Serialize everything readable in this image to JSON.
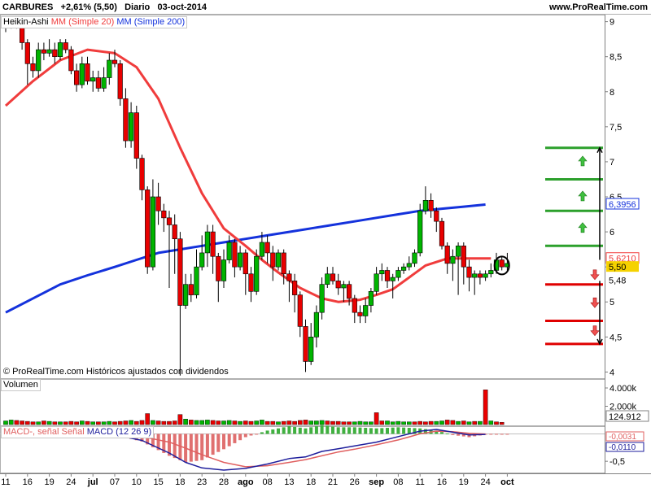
{
  "header": {
    "ticker": "CARBURES",
    "change": "+2,61% (5,50)",
    "period": "Diario",
    "date": "03-oct-2014",
    "site": "www.ProRealTime.com"
  },
  "copyright": "© ProRealTime.com Históricos ajustados con dividendos",
  "colors": {
    "up": "#00b400",
    "down": "#e80000",
    "sma20": "#f03c3c",
    "sma200": "#1432dc",
    "green_line": "#2ca02c",
    "red_line": "#e00000",
    "macd": "#1e1e9c",
    "signal": "#e06060"
  },
  "price_legend": {
    "ha": "Heikin-Ashi",
    "ma20": "MM (Simple 20)",
    "ma200": "MM (Simple 200)"
  },
  "volume_legend": "Volumen",
  "macd_legend": {
    "macd_hist": "MACD-, señal",
    "signal": "Señal",
    "macd": "MACD (12 26 9)"
  },
  "chart_data": [
    {
      "type": "candlestick",
      "title": "CARBURES",
      "ylim": [
        3.9,
        9.1
      ],
      "y_ticks": [
        "9",
        "8,5",
        "8",
        "7,5",
        "7",
        "6,5",
        "6",
        "5,5",
        "5",
        "4,5",
        "4"
      ],
      "x_date_labels": [
        "11",
        "16",
        "19",
        "24",
        "jul",
        "07",
        "10",
        "15",
        "18",
        "23",
        "28",
        "ago",
        "08",
        "13",
        "18",
        "21",
        "26",
        "sep",
        "08",
        "11",
        "16",
        "19",
        "24",
        "oct"
      ],
      "candles": [
        [
          8.95,
          8.95,
          9.05,
          8.85
        ],
        [
          8.95,
          9.0,
          9.05,
          8.9
        ],
        [
          9.0,
          8.95,
          9.05,
          8.9
        ],
        [
          8.95,
          8.7,
          8.95,
          8.6
        ],
        [
          8.7,
          8.4,
          8.75,
          8.1
        ],
        [
          8.4,
          8.3,
          8.5,
          8.2
        ],
        [
          8.3,
          8.6,
          8.7,
          8.2
        ],
        [
          8.6,
          8.55,
          8.7,
          8.45
        ],
        [
          8.55,
          8.6,
          8.75,
          8.5
        ],
        [
          8.6,
          8.5,
          8.7,
          8.4
        ],
        [
          8.5,
          8.7,
          8.75,
          8.45
        ],
        [
          8.7,
          8.6,
          8.75,
          8.55
        ],
        [
          8.6,
          8.3,
          8.65,
          8.25
        ],
        [
          8.3,
          8.1,
          8.4,
          8.0
        ],
        [
          8.1,
          8.4,
          8.5,
          8.05
        ],
        [
          8.4,
          8.15,
          8.5,
          8.1
        ],
        [
          8.15,
          8.2,
          8.3,
          8.0
        ],
        [
          8.2,
          8.05,
          8.3,
          8.0
        ],
        [
          8.05,
          8.2,
          8.35,
          8.0
        ],
        [
          8.2,
          8.45,
          8.55,
          8.1
        ],
        [
          8.45,
          8.4,
          8.6,
          8.35
        ],
        [
          8.4,
          7.9,
          8.45,
          7.8
        ],
        [
          7.9,
          7.3,
          8.05,
          7.2
        ],
        [
          7.3,
          7.7,
          7.85,
          7.2
        ],
        [
          7.7,
          7.05,
          7.8,
          6.9
        ],
        [
          7.05,
          6.6,
          7.1,
          6.45
        ],
        [
          6.6,
          5.5,
          6.65,
          5.4
        ],
        [
          5.5,
          6.5,
          6.75,
          5.45
        ],
        [
          6.5,
          6.3,
          6.7,
          6.1
        ],
        [
          6.3,
          6.2,
          6.4,
          6.0
        ],
        [
          6.2,
          6.1,
          6.3,
          5.2
        ],
        [
          6.1,
          5.9,
          6.25,
          5.4
        ],
        [
          5.9,
          4.95,
          6.0,
          3.95
        ],
        [
          4.95,
          5.25,
          5.4,
          4.9
        ],
        [
          5.25,
          5.1,
          5.4,
          5.0
        ],
        [
          5.1,
          5.5,
          5.75,
          5.05
        ],
        [
          5.5,
          5.7,
          5.95,
          5.45
        ],
        [
          5.7,
          6.0,
          6.1,
          5.5
        ],
        [
          6.0,
          5.65,
          6.1,
          5.4
        ],
        [
          5.65,
          5.3,
          5.7,
          5.0
        ],
        [
          5.3,
          5.6,
          5.75,
          5.2
        ],
        [
          5.6,
          5.85,
          5.95,
          5.55
        ],
        [
          5.85,
          5.5,
          5.9,
          5.35
        ],
        [
          5.5,
          5.7,
          5.8,
          5.45
        ],
        [
          5.7,
          5.4,
          5.75,
          5.1
        ],
        [
          5.4,
          5.15,
          5.5,
          5.0
        ],
        [
          5.15,
          5.65,
          5.75,
          5.1
        ],
        [
          5.65,
          5.85,
          6.0,
          5.6
        ],
        [
          5.85,
          5.7,
          5.95,
          5.55
        ],
        [
          5.7,
          5.5,
          5.8,
          5.3
        ],
        [
          5.5,
          5.7,
          5.75,
          5.45
        ],
        [
          5.7,
          5.4,
          5.75,
          5.25
        ],
        [
          5.4,
          5.3,
          5.45,
          5.0
        ],
        [
          5.3,
          5.1,
          5.4,
          4.85
        ],
        [
          5.1,
          4.65,
          5.15,
          4.5
        ],
        [
          4.65,
          4.15,
          4.75,
          4.0
        ],
        [
          4.15,
          4.5,
          4.7,
          4.1
        ],
        [
          4.5,
          4.85,
          4.95,
          4.35
        ],
        [
          4.85,
          5.25,
          5.35,
          4.75
        ],
        [
          5.25,
          5.4,
          5.5,
          5.2
        ],
        [
          5.4,
          5.3,
          5.5,
          5.25
        ],
        [
          5.3,
          5.2,
          5.4,
          5.1
        ],
        [
          5.2,
          5.25,
          5.3,
          5.0
        ],
        [
          5.25,
          5.05,
          5.3,
          4.95
        ],
        [
          5.05,
          4.85,
          5.1,
          4.7
        ],
        [
          4.85,
          4.8,
          4.95,
          4.7
        ],
        [
          4.8,
          4.95,
          5.05,
          4.7
        ],
        [
          4.95,
          5.15,
          5.2,
          4.85
        ],
        [
          5.15,
          5.4,
          5.5,
          5.1
        ],
        [
          5.4,
          5.45,
          5.55,
          5.3
        ],
        [
          5.45,
          5.3,
          5.5,
          5.2
        ],
        [
          5.3,
          5.35,
          5.4,
          5.05
        ],
        [
          5.35,
          5.45,
          5.5,
          5.3
        ],
        [
          5.45,
          5.5,
          5.55,
          5.4
        ],
        [
          5.5,
          5.55,
          5.65,
          5.45
        ],
        [
          5.55,
          5.7,
          5.75,
          5.5
        ],
        [
          5.7,
          6.3,
          6.4,
          5.65
        ],
        [
          6.3,
          6.45,
          6.65,
          6.25
        ],
        [
          6.45,
          6.3,
          6.55,
          6.2
        ],
        [
          6.3,
          6.15,
          6.35,
          6.0
        ],
        [
          6.15,
          5.8,
          6.2,
          5.75
        ],
        [
          5.8,
          5.55,
          5.85,
          5.4
        ],
        [
          5.55,
          5.65,
          5.75,
          5.3
        ],
        [
          5.65,
          5.8,
          5.85,
          5.1
        ],
        [
          5.8,
          5.5,
          5.85,
          5.25
        ],
        [
          5.5,
          5.35,
          5.6,
          5.15
        ],
        [
          5.35,
          5.4,
          5.45,
          5.1
        ],
        [
          5.4,
          5.35,
          5.45,
          5.25
        ],
        [
          5.35,
          5.4,
          5.45,
          5.3
        ],
        [
          5.4,
          5.45,
          5.55,
          5.35
        ],
        [
          5.45,
          5.6,
          5.7,
          5.4
        ],
        [
          5.6,
          5.5,
          5.65,
          5.45
        ],
        [
          5.5,
          5.55,
          5.7,
          5.45
        ]
      ],
      "sma20": [
        [
          0,
          7.8
        ],
        [
          5,
          8.15
        ],
        [
          10,
          8.45
        ],
        [
          15,
          8.6
        ],
        [
          20,
          8.55
        ],
        [
          24,
          8.35
        ],
        [
          28,
          7.9
        ],
        [
          32,
          7.2
        ],
        [
          36,
          6.55
        ],
        [
          40,
          6.05
        ],
        [
          44,
          5.8
        ],
        [
          47,
          5.6
        ],
        [
          50,
          5.42
        ],
        [
          54,
          5.2
        ],
        [
          58,
          5.05
        ],
        [
          61,
          5.0
        ],
        [
          65,
          5.03
        ],
        [
          68,
          5.1
        ],
        [
          71,
          5.18
        ],
        [
          74,
          5.35
        ],
        [
          77,
          5.52
        ],
        [
          81,
          5.62
        ],
        [
          85,
          5.62
        ],
        [
          89,
          5.62
        ]
      ],
      "sma200": [
        [
          0,
          4.85
        ],
        [
          5,
          5.05
        ],
        [
          10,
          5.25
        ],
        [
          15,
          5.38
        ],
        [
          20,
          5.5
        ],
        [
          24,
          5.6
        ],
        [
          28,
          5.7
        ],
        [
          32,
          5.75
        ],
        [
          36,
          5.8
        ],
        [
          40,
          5.85
        ],
        [
          44,
          5.9
        ],
        [
          48,
          5.95
        ],
        [
          52,
          6.0
        ],
        [
          56,
          6.05
        ],
        [
          60,
          6.1
        ],
        [
          64,
          6.15
        ],
        [
          68,
          6.2
        ],
        [
          72,
          6.25
        ],
        [
          76,
          6.3
        ],
        [
          80,
          6.33
        ],
        [
          84,
          6.36
        ],
        [
          88,
          6.39
        ]
      ],
      "levels": {
        "green": [
          7.2,
          6.75,
          6.3,
          5.8
        ],
        "red": [
          5.25,
          4.73,
          4.4
        ]
      },
      "price_tags": {
        "sma200": "6,3956",
        "sma20": "5,6210",
        "last": "5,50",
        "low": "5,48"
      }
    },
    {
      "type": "bar",
      "title": "Volumen",
      "y_ticks": [
        "4.000k",
        "2.000k"
      ],
      "ylim": [
        0,
        4800
      ],
      "last_value": "124.912",
      "values": [
        400,
        500,
        450,
        400,
        350,
        300,
        300,
        400,
        350,
        300,
        300,
        300,
        350,
        300,
        400,
        350,
        300,
        300,
        300,
        350,
        300,
        350,
        400,
        450,
        350,
        450,
        1200,
        450,
        400,
        350,
        350,
        400,
        1100,
        600,
        500,
        450,
        450,
        500,
        450,
        400,
        400,
        450,
        400,
        350,
        400,
        350,
        400,
        500,
        350,
        350,
        300,
        350,
        400,
        350,
        450,
        500,
        400,
        400,
        450,
        400,
        350,
        350,
        300,
        300,
        300,
        350,
        300,
        300,
        1300,
        400,
        400,
        300,
        350,
        300,
        300,
        300,
        350,
        300,
        350,
        350,
        400,
        500,
        450,
        350,
        400,
        300,
        350,
        350,
        3800,
        400,
        300,
        250
      ],
      "up": [
        1,
        1,
        0,
        0,
        0,
        0,
        1,
        0,
        1,
        0,
        1,
        0,
        0,
        0,
        1,
        0,
        1,
        0,
        1,
        1,
        0,
        0,
        0,
        1,
        0,
        0,
        0,
        1,
        0,
        0,
        0,
        0,
        0,
        1,
        0,
        1,
        1,
        1,
        0,
        0,
        1,
        1,
        0,
        1,
        0,
        0,
        1,
        1,
        0,
        0,
        1,
        0,
        0,
        0,
        0,
        0,
        1,
        1,
        1,
        0,
        0,
        0,
        0,
        0,
        1,
        1,
        1,
        1,
        0,
        0,
        1,
        1,
        1,
        1,
        1,
        0,
        0,
        0,
        0,
        1,
        1,
        0,
        0,
        1,
        0,
        1,
        0,
        1,
        0,
        1,
        0
      ]
    },
    {
      "type": "line",
      "title": "MACD (12 26 9)",
      "y_ticks": [
        "-0,5"
      ],
      "ylim": [
        -0.72,
        0.14
      ],
      "values_shown": {
        "signal": "-0,0031",
        "macd": "-0,0110"
      },
      "macd": [
        [
          0,
          0.02
        ],
        [
          5,
          0.02
        ],
        [
          10,
          0.01
        ],
        [
          15,
          0.0
        ],
        [
          20,
          -0.02
        ],
        [
          25,
          -0.12
        ],
        [
          30,
          -0.35
        ],
        [
          33,
          -0.52
        ],
        [
          36,
          -0.62
        ],
        [
          40,
          -0.66
        ],
        [
          44,
          -0.63
        ],
        [
          48,
          -0.55
        ],
        [
          52,
          -0.45
        ],
        [
          55,
          -0.42
        ],
        [
          58,
          -0.32
        ],
        [
          61,
          -0.27
        ],
        [
          64,
          -0.22
        ],
        [
          68,
          -0.15
        ],
        [
          72,
          -0.05
        ],
        [
          76,
          0.05
        ],
        [
          79,
          0.08
        ],
        [
          82,
          0.03
        ],
        [
          85,
          -0.02
        ],
        [
          88,
          -0.01
        ]
      ],
      "signal": [
        [
          0,
          0.02
        ],
        [
          5,
          0.02
        ],
        [
          10,
          0.015
        ],
        [
          15,
          0.005
        ],
        [
          20,
          -0.01
        ],
        [
          25,
          -0.05
        ],
        [
          30,
          -0.15
        ],
        [
          33,
          -0.26
        ],
        [
          36,
          -0.38
        ],
        [
          40,
          -0.52
        ],
        [
          44,
          -0.6
        ],
        [
          48,
          -0.58
        ],
        [
          52,
          -0.52
        ],
        [
          55,
          -0.47
        ],
        [
          58,
          -0.4
        ],
        [
          61,
          -0.33
        ],
        [
          64,
          -0.28
        ],
        [
          68,
          -0.2
        ],
        [
          72,
          -0.11
        ],
        [
          76,
          0.0
        ],
        [
          79,
          0.05
        ],
        [
          82,
          0.04
        ],
        [
          85,
          0.01
        ],
        [
          88,
          -0.003
        ]
      ]
    }
  ]
}
